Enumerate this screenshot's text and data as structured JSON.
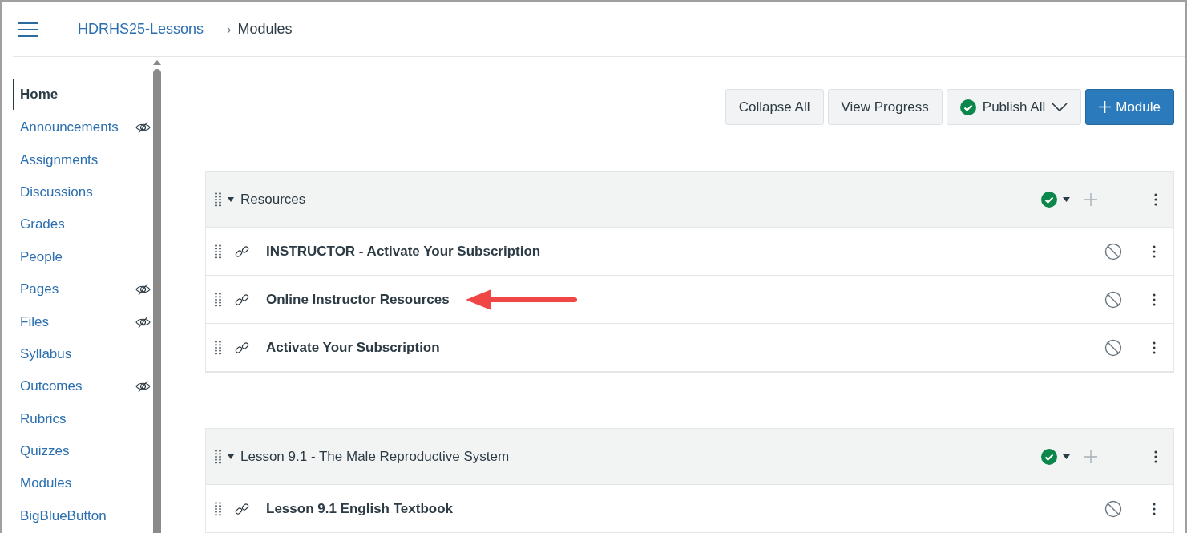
{
  "breadcrumb_separator": "›",
  "breadcrumb": [
    {
      "label": "HDRHS25-Lessons",
      "link": true
    },
    {
      "label": "Modules",
      "link": false
    }
  ],
  "sidebar": {
    "items": [
      {
        "label": "Home",
        "selected": true,
        "hidden": false
      },
      {
        "label": "Announcements",
        "selected": false,
        "hidden": true
      },
      {
        "label": "Assignments",
        "selected": false,
        "hidden": false
      },
      {
        "label": "Discussions",
        "selected": false,
        "hidden": false
      },
      {
        "label": "Grades",
        "selected": false,
        "hidden": false
      },
      {
        "label": "People",
        "selected": false,
        "hidden": false
      },
      {
        "label": "Pages",
        "selected": false,
        "hidden": true
      },
      {
        "label": "Files",
        "selected": false,
        "hidden": true
      },
      {
        "label": "Syllabus",
        "selected": false,
        "hidden": false
      },
      {
        "label": "Outcomes",
        "selected": false,
        "hidden": true
      },
      {
        "label": "Rubrics",
        "selected": false,
        "hidden": false
      },
      {
        "label": "Quizzes",
        "selected": false,
        "hidden": false
      },
      {
        "label": "Modules",
        "selected": false,
        "hidden": false
      },
      {
        "label": "BigBlueButton",
        "selected": false,
        "hidden": false
      }
    ]
  },
  "toolbar": {
    "buttons": [
      {
        "label": "Collapse All",
        "kind": "plain"
      },
      {
        "label": "View Progress",
        "kind": "plain"
      },
      {
        "label": "Publish All",
        "kind": "publish"
      },
      {
        "label": "Module",
        "kind": "primary"
      }
    ]
  },
  "modules": [
    {
      "title": "Resources",
      "expanded": true,
      "published": true,
      "items": [
        {
          "title": "INSTRUCTOR - Activate Your Subscription",
          "published": false,
          "arrow": false
        },
        {
          "title": "Online Instructor Resources",
          "published": false,
          "arrow": true
        },
        {
          "title": "Activate Your Subscription",
          "published": false,
          "arrow": false
        }
      ]
    },
    {
      "title": "Lesson 9.1 - The Male Reproductive System",
      "expanded": true,
      "published": true,
      "items": [
        {
          "title": "Lesson 9.1 English Textbook",
          "published": false,
          "arrow": false
        }
      ]
    }
  ]
}
